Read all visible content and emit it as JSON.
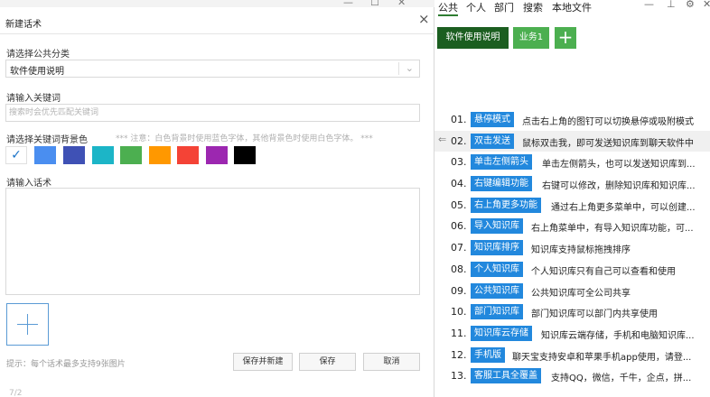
{
  "dialog": {
    "ghost_buttons": [
      "—",
      "☐",
      "✕"
    ],
    "title": "新建话术",
    "close_glyph": "×",
    "category_label": "请选择公共分类",
    "category_value": "软件使用说明",
    "keyword_label": "请输入关键词",
    "keyword_placeholder": "搜索时会优先匹配关键词",
    "color_label": "请选择关键词背景色",
    "color_note": "*** 注意：白色背景时使用蓝色字体，其他背景色时使用白色字体。 ***",
    "colors": [
      "#ffffff",
      "#4a8ef0",
      "#3f51b5",
      "#1cb5c7",
      "#4caf50",
      "#ff9800",
      "#f44336",
      "#9c27b0",
      "#000000"
    ],
    "selected_check": "✓",
    "speech_label": "请输入话术",
    "hint": "提示：每个话术最多支持9张图片",
    "save_new": "保存并新建",
    "save": "保存",
    "cancel": "取消",
    "page_indicator": "7/2"
  },
  "panel": {
    "tabs": [
      "公共",
      "个人",
      "部门",
      "搜索",
      "本地文件"
    ],
    "top_icons": [
      "—",
      "⊥",
      "⚙",
      "✕"
    ],
    "categories": [
      {
        "label": "软件使用说明",
        "color": "#1b5e20"
      },
      {
        "label": "业务1",
        "color": "#4caf50"
      }
    ],
    "add_category": "+",
    "back_arrow": "⇐",
    "items": [
      {
        "num": "01.",
        "tag": "悬停模式",
        "desc": "点击右上角的图钉可以切换悬停或吸附模式"
      },
      {
        "num": "02.",
        "tag": "双击发送",
        "desc": "鼠标双击我，即可发送知识库到聊天软件中"
      },
      {
        "num": "03.",
        "tag": "单击左侧箭头",
        "desc": "单击左侧箭头，也可以发送知识库到..."
      },
      {
        "num": "04.",
        "tag": "右键编辑功能",
        "desc": "右键可以修改，删除知识库和知识库..."
      },
      {
        "num": "05.",
        "tag": "右上角更多功能",
        "desc": "通过右上角更多菜单中，可以创建..."
      },
      {
        "num": "06.",
        "tag": "导入知识库",
        "desc": "右上角菜单中，有导入知识库功能，可..."
      },
      {
        "num": "07.",
        "tag": "知识库排序",
        "desc": "知识库支持鼠标拖拽排序"
      },
      {
        "num": "08.",
        "tag": "个人知识库",
        "desc": "个人知识库只有自己可以查看和使用"
      },
      {
        "num": "09.",
        "tag": "公共知识库",
        "desc": "公共知识库可全公司共享"
      },
      {
        "num": "10.",
        "tag": "部门知识库",
        "desc": "部门知识库可以部门内共享使用"
      },
      {
        "num": "11.",
        "tag": "知识库云存储",
        "desc": "知识库云端存储，手机和电脑知识库..."
      },
      {
        "num": "12.",
        "tag": "手机版",
        "desc": "聊天宝支持安卓和苹果手机app使用，请登..."
      },
      {
        "num": "13.",
        "tag": "客服工具全覆盖",
        "desc": "支持QQ，微信，千牛，企点，拼..."
      }
    ]
  }
}
